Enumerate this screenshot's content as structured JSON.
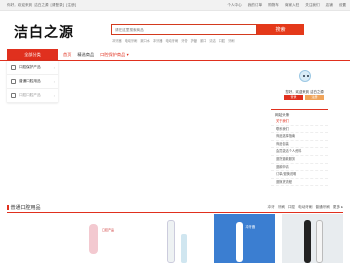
{
  "topbar": {
    "left": [
      "你好，欢迎来到",
      "洁白之源",
      "[请登录]",
      "[注册]"
    ],
    "right": [
      "个人中心",
      "我的订单",
      "购物车",
      "商家入驻",
      "关注我们",
      "店铺",
      "设置"
    ]
  },
  "logo": "洁白之源",
  "search": {
    "placeholder": "请在这里搜索商品",
    "button": "搜索"
  },
  "hotwords": [
    "冲牙器",
    "电动牙刷",
    "漱口水",
    "冲牙器",
    "电动牙刷",
    "牙膏",
    "护龈",
    "漱口",
    "清洁",
    "口腔",
    "牙刷"
  ],
  "nav": {
    "category": "全部分类",
    "items": [
      {
        "label": "首页",
        "state": "active"
      },
      {
        "label": "精选商品",
        "state": "normal"
      },
      {
        "label": "口腔保护商品 ▾",
        "state": "red"
      }
    ]
  },
  "categories": [
    {
      "label": "口腔保护产品",
      "selected": false
    },
    {
      "label": "普通口腔用品",
      "selected": false
    },
    {
      "label": "口腔口腔产品",
      "selected": true
    }
  ],
  "user": {
    "greeting": "您好，欢迎来到 洁白之源",
    "login": "登录",
    "register": "注册"
  },
  "notice": {
    "title": "网站头条",
    "lines": [
      "关于我们",
      "联系我们",
      "商品选择指南",
      "商品包装",
      "会员激活个人资料",
      "退货退款服务",
      "退款申请",
      "订单/退换说明",
      "退换货流程"
    ]
  },
  "section": {
    "title": "普通口腔用品",
    "tabs": [
      "冲牙",
      "牙刷",
      "口腔",
      "电动牙刷",
      "普通牙刷",
      "更多 ▸"
    ]
  },
  "products": [
    {
      "tag": "口腔产品"
    },
    {
      "tag": ""
    },
    {
      "tag": "冲牙器"
    },
    {
      "tag": ""
    }
  ]
}
